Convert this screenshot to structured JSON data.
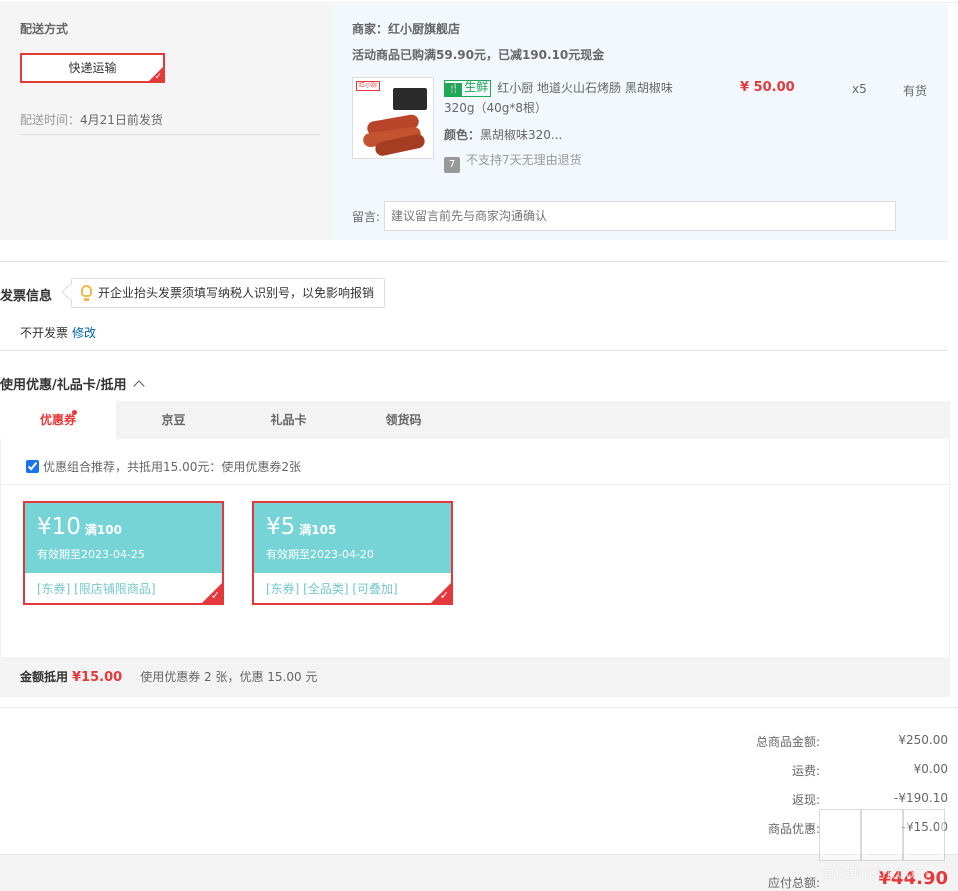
{
  "shipping": {
    "title": "配送方式",
    "method": "快递运输",
    "time_label": "配送时间：",
    "time_value": "4月21日前发货"
  },
  "shop": {
    "name": "商家：红小厨旗舰店",
    "promo": "活动商品已购满59.90元，已减190.10元现金",
    "thumb_logo": "红小厨"
  },
  "product": {
    "tag_fresh": "生鲜",
    "tag_icon": "fork-icon",
    "name": "红小厨 地道火山石烤肠 黑胡椒味 320g（40g*8根）",
    "color_label": "颜色：",
    "color_value": "黑胡椒味320...",
    "no_return_icon": "7",
    "no_return": "不支持7天无理由退货",
    "price": "¥ 50.00",
    "qty": "x5",
    "stock": "有货"
  },
  "message": {
    "label": "留言:",
    "placeholder": "建议留言前先与商家沟通确认"
  },
  "invoice": {
    "title": "发票信息",
    "tip": "开企业抬头发票须填写纳税人识别号，以免影响报销",
    "value": "不开发票",
    "edit": "修改"
  },
  "coupons": {
    "section_title": "使用优惠/礼品卡/抵用",
    "tabs": [
      "优惠券",
      "京豆",
      "礼品卡",
      "领货码"
    ],
    "combo_text": "优惠组合推荐，共抵用15.00元：使用优惠券2张",
    "items": [
      {
        "amount": "¥10",
        "cond": "满100",
        "expiry": "有效期至2023-04-25",
        "tags": "[东券]  [限店铺限商品]"
      },
      {
        "amount": "¥5",
        "cond": "满105",
        "expiry": "有效期至2023-04-20",
        "tags": "[东券]  [全品类]  [可叠加]"
      }
    ],
    "summary_label": "金额抵用",
    "summary_amount": "¥15.00",
    "summary_text": "使用优惠券 2 张，优惠 15.00 元"
  },
  "totals": {
    "rows": [
      {
        "label": "总商品金额:",
        "value": "¥250.00"
      },
      {
        "label": "运费:",
        "value": "¥0.00"
      },
      {
        "label": "返现:",
        "value": "-¥190.10"
      },
      {
        "label": "商品优惠:",
        "value": "-¥15.00"
      }
    ],
    "pay_label": "应付总额:",
    "pay_value": "¥44.90"
  },
  "watermark": "zhizhizhi.com",
  "colors": {
    "accent": "#e4393c",
    "coupon": "#76d3d6",
    "fresh": "#1fa855",
    "link": "#005ea7"
  }
}
